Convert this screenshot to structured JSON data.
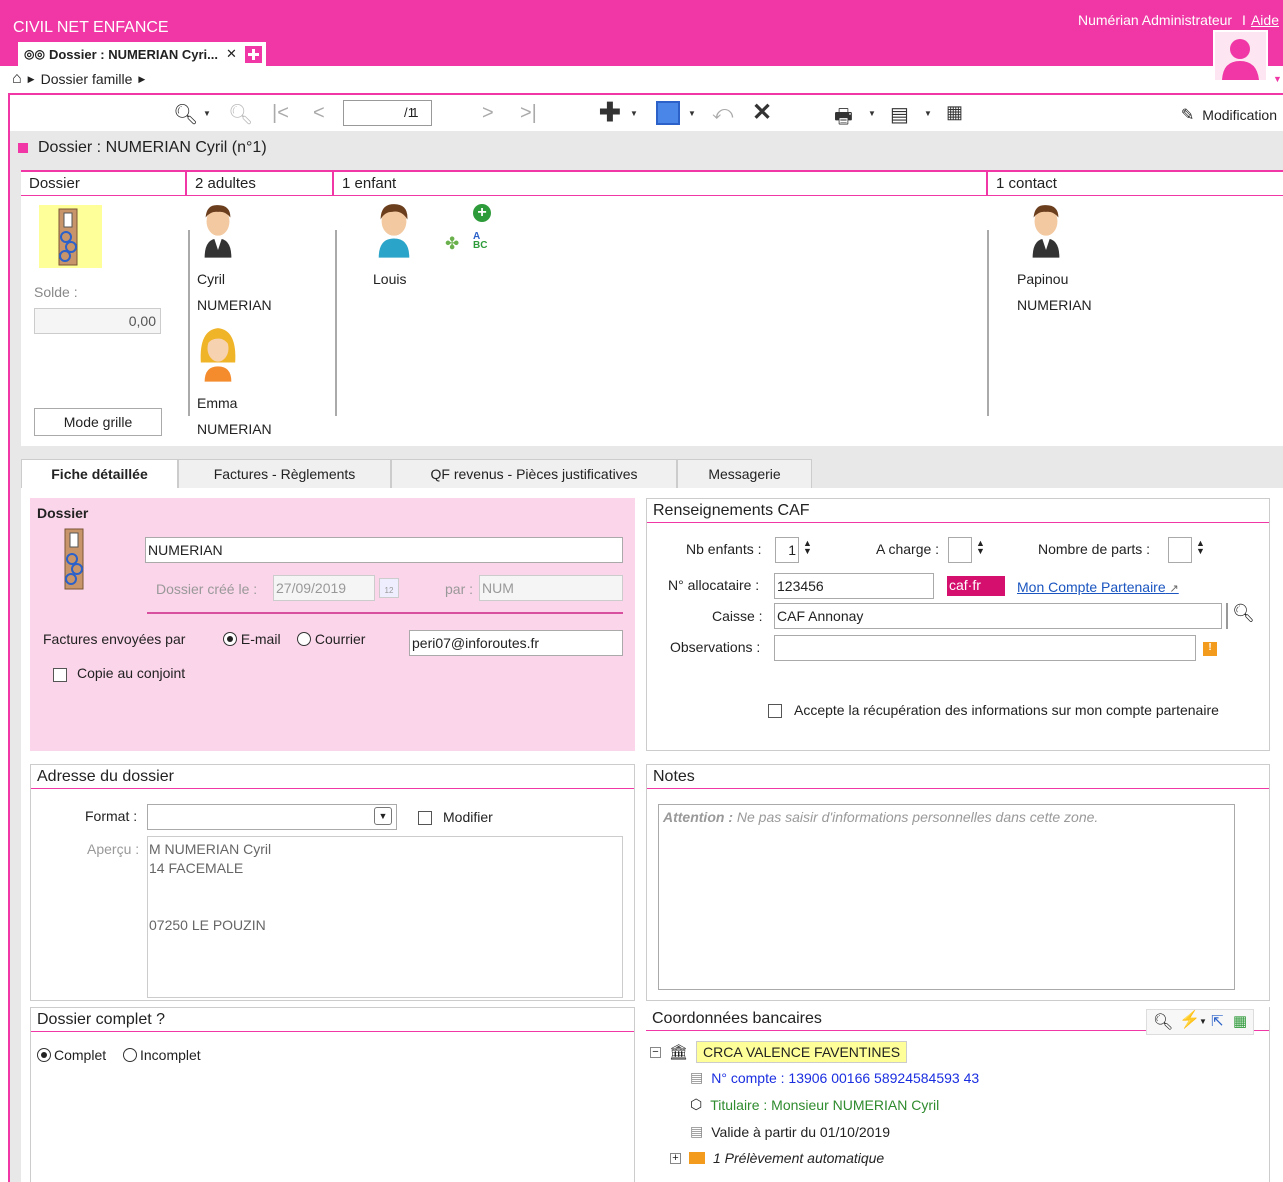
{
  "app": {
    "title": "CIVIL NET ENFANCE",
    "user": "Numérian Administrateur",
    "help": "Aide",
    "separator": "I"
  },
  "tab": {
    "label": "Dossier : NUMERIAN Cyri..."
  },
  "breadcrumb": {
    "label": "Dossier famille"
  },
  "toolbar": {
    "page": "1",
    "page_total": "/ 1",
    "mode": "Modification"
  },
  "page_title": "Dossier : NUMERIAN Cyril (n°1)",
  "family": {
    "headers": {
      "dossier": "Dossier",
      "adults": "2 adultes",
      "children": "1 enfant",
      "contacts": "1 contact"
    },
    "solde_label": "Solde :",
    "solde_value": "0,00",
    "grid_button": "Mode grille",
    "adults": [
      {
        "first": "Cyril",
        "last": "NUMERIAN"
      },
      {
        "first": "Emma",
        "last": "NUMERIAN"
      }
    ],
    "child": {
      "first": "Louis"
    },
    "contact": {
      "first": "Papinou",
      "last": "NUMERIAN"
    }
  },
  "tabs": [
    "Fiche détaillée",
    "Factures - Règlements",
    "QF revenus - Pièces justificatives",
    "Messagerie"
  ],
  "dossier": {
    "title": "Dossier",
    "name": "NUMERIAN",
    "created_label": "Dossier créé le :",
    "created_value": "27/09/2019",
    "calendar_day": "12",
    "by_label": "par :",
    "by_value": "NUM",
    "invoices_label": "Factures envoyées par",
    "email_label": "E-mail",
    "mail_label": "Courrier",
    "email_value": "peri07@inforoutes.fr",
    "copy_label": "Copie au conjoint"
  },
  "caf": {
    "title": "Renseignements CAF",
    "nb_enfants_label": "Nb enfants :",
    "nb_enfants_value": "1",
    "a_charge_label": "A charge :",
    "parts_label": "Nombre de parts :",
    "allocataire_label": "N° allocataire :",
    "allocataire_value": "123456",
    "caf_logo": "caf·fr",
    "partner_link": "Mon Compte Partenaire",
    "caisse_label": "Caisse :",
    "caisse_value": "CAF Annonay",
    "obs_label": "Observations :",
    "accept_label": "Accepte la récupération des informations sur mon compte partenaire"
  },
  "address": {
    "title": "Adresse du dossier",
    "format_label": "Format :",
    "modify_label": "Modifier",
    "preview_label": "Aperçu :",
    "lines": [
      "M NUMERIAN Cyril",
      "14 FACEMALE",
      "",
      "",
      "07250 LE POUZIN"
    ]
  },
  "notes": {
    "title": "Notes",
    "warning_bold": "Attention :",
    "warning": " Ne pas saisir d'informations personnelles dans cette zone."
  },
  "complete": {
    "title": "Dossier complet ?",
    "complete_label": "Complet",
    "incomplete_label": "Incomplet"
  },
  "bank": {
    "title": "Coordonnées bancaires",
    "bank_name": "CRCA VALENCE FAVENTINES",
    "account": "N° compte : 13906 00166 58924584593 43",
    "holder": "Titulaire : Monsieur NUMERIAN Cyril",
    "valid": "Valide à partir du 01/10/2019",
    "debit": "1 Prélèvement automatique"
  },
  "colors": {
    "accent": "#f037a5",
    "panel_pink": "#fbd5ea"
  }
}
